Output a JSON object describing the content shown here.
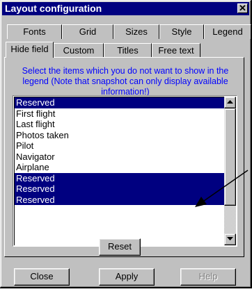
{
  "window": {
    "title": "Layout configuration"
  },
  "tabs_row_back": [
    {
      "label": "Fonts"
    },
    {
      "label": "Grid"
    },
    {
      "label": "Sizes"
    },
    {
      "label": "Style"
    },
    {
      "label": "Legend"
    }
  ],
  "tabs_row_front": [
    {
      "label": "Hide field",
      "active": true
    },
    {
      "label": "Custom"
    },
    {
      "label": "Titles"
    },
    {
      "label": "Free text"
    }
  ],
  "instructions": "Select the items which you do not want to show in the legend (Note that snapshot can only display available information!)",
  "list": {
    "items": [
      {
        "label": "Reserved",
        "selected": true
      },
      {
        "label": "First flight",
        "selected": false
      },
      {
        "label": "Last flight",
        "selected": false
      },
      {
        "label": "Photos taken",
        "selected": false
      },
      {
        "label": "Pilot",
        "selected": false
      },
      {
        "label": "Navigator",
        "selected": false
      },
      {
        "label": "Airplane",
        "selected": false
      },
      {
        "label": "Reserved",
        "selected": true
      },
      {
        "label": "Reserved",
        "selected": true
      },
      {
        "label": "Reserved",
        "selected": true
      }
    ]
  },
  "buttons": {
    "reset": "Reset",
    "close": "Close",
    "apply": "Apply",
    "help": "Help"
  },
  "colors": {
    "title_bar": "#000080",
    "selection": "#000080",
    "instruction_text": "#0000ff",
    "face": "#c0c0c0"
  }
}
